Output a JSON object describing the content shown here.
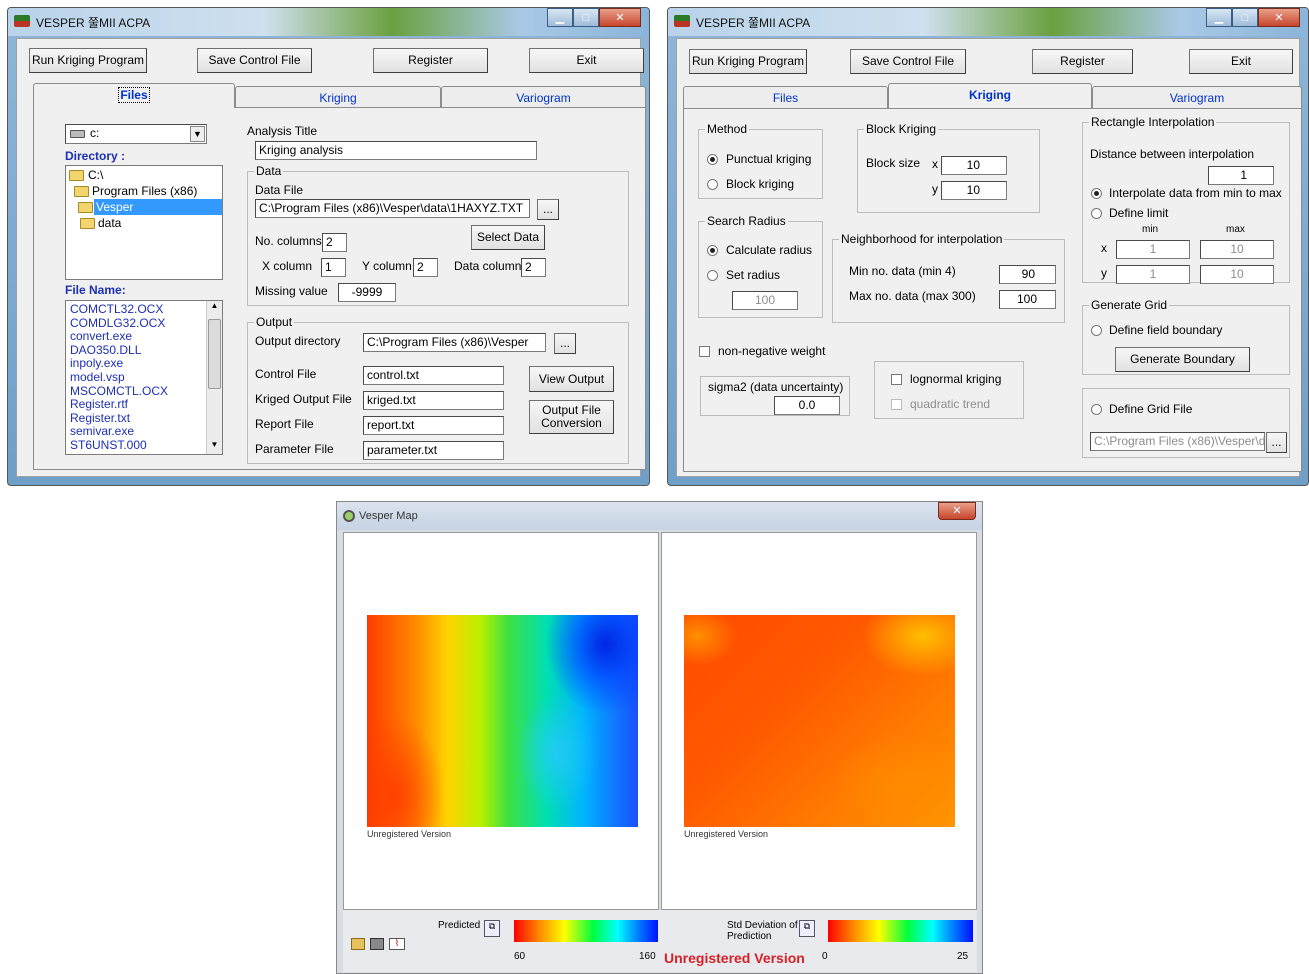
{
  "win1": {
    "title": "VESPER 쭐MII ACPA",
    "toolbar": {
      "run": "Run Kriging Program",
      "save": "Save Control File",
      "register": "Register",
      "exit": "Exit"
    },
    "tabs": [
      "Files",
      "Kriging",
      "Variogram"
    ],
    "drive": "c:",
    "directory_label": "Directory :",
    "dirs": [
      "C:\\",
      "Program Files (x86)",
      "Vesper",
      "data"
    ],
    "filename_label": "File Name:",
    "files": [
      "COMCTL32.OCX",
      "COMDLG32.OCX",
      "convert.exe",
      "DAO350.DLL",
      "inpoly.exe",
      "model.vsp",
      "MSCOMCTL.OCX",
      "Register.rtf",
      "Register.txt",
      "semivar.exe",
      "ST6UNST.000"
    ],
    "analysis_title_label": "Analysis Title",
    "analysis_title": "Kriging analysis",
    "data_group": "Data",
    "data_file_label": "Data File",
    "data_file": "C:\\Program Files (x86)\\Vesper\\data\\1HAXYZ.TXT",
    "browse": "...",
    "no_columns_label": "No. columns",
    "no_columns": "2",
    "select_data": "Select Data",
    "x_column_label": "X column",
    "x_column": "1",
    "y_column_label": "Y column",
    "y_column": "2",
    "data_column_label": "Data column",
    "data_column": "2",
    "missing_label": "Missing value",
    "missing": "-9999",
    "output_group": "Output",
    "out_dir_label": "Output directory",
    "out_dir": "C:\\Program Files (x86)\\Vesper",
    "control_label": "Control File",
    "control": "control.txt",
    "kriged_label": "Kriged Output File",
    "kriged": "kriged.txt",
    "report_label": "Report File",
    "report": "report.txt",
    "param_label": "Parameter File",
    "param": "parameter.txt",
    "view_output": "View Output",
    "conv1": "Output File",
    "conv2": "Conversion"
  },
  "win2": {
    "title": "VESPER 쭐MII ACPA",
    "toolbar": {
      "run": "Run Kriging Program",
      "save": "Save Control File",
      "register": "Register",
      "exit": "Exit"
    },
    "tabs": [
      "Files",
      "Kriging",
      "Variogram"
    ],
    "method_group": "Method",
    "punctual": "Punctual kriging",
    "block": "Block kriging",
    "block_group": "Block Kriging",
    "block_size": "Block size",
    "bx_label": "x",
    "bx": "10",
    "by_label": "y",
    "by": "10",
    "rect_group": "Rectangle Interpolation",
    "distance_label": "Distance between interpolation",
    "distance": "1",
    "interp_minmax": "Interpolate data from min to max",
    "define_limit": "Define limit",
    "min_label": "min",
    "max_label": "max",
    "x_label": "x",
    "xmin": "1",
    "xmax": "10",
    "y_label": "y",
    "ymin": "1",
    "ymax": "10",
    "search_group": "Search Radius",
    "calc_radius": "Calculate radius",
    "set_radius": "Set radius",
    "radius": "100",
    "neigh_group": "Neighborhood for interpolation",
    "min_no_label": "Min no. data (min 4)",
    "min_no": "90",
    "max_no_label": "Max no. data (max 300)",
    "max_no": "100",
    "gen_grid_group": "Generate Grid",
    "define_boundary": "Define field boundary",
    "generate_boundary": "Generate Boundary",
    "nonneg": "non-negative weight",
    "sigma_label": "sigma2 (data uncertainty)",
    "sigma": "0.0",
    "lognormal": "lognormal kriging",
    "quadratic": "quadratic trend",
    "define_grid_file": "Define Grid File",
    "grid_file": "C:\\Program Files (x86)\\Vesper\\d",
    "browse": "..."
  },
  "map": {
    "title": "Vesper Map",
    "unreg_left": "Unregistered Version",
    "unreg_right": "Unregistered Version",
    "predicted_label": "Predicted",
    "pred_min": "60",
    "pred_max": "160",
    "std_label_1": "Std Deviation of",
    "std_label_2": "Prediction",
    "std_min": "0",
    "std_max": "25",
    "unregistered_banner": "Unregistered Version",
    "colors": {
      "accent_red": "#d81f26"
    }
  }
}
